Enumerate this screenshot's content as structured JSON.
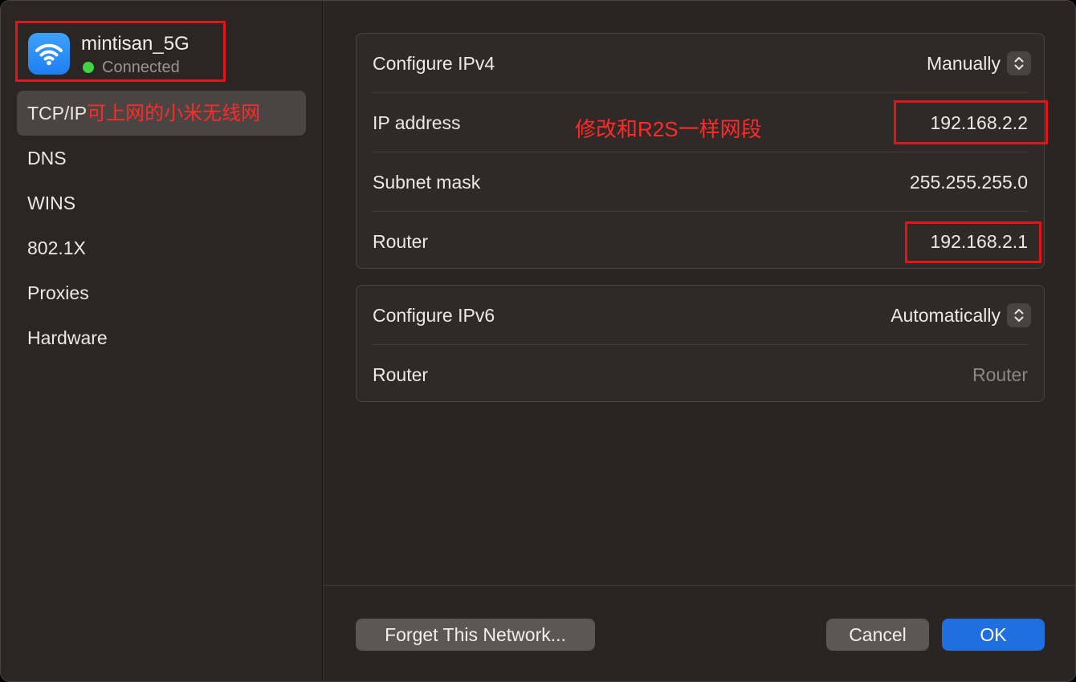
{
  "network": {
    "name": "mintisan_5G",
    "status": "Connected",
    "status_color": "#3fd443",
    "icon": "wifi-icon"
  },
  "sidebar": {
    "items": [
      {
        "label": "TCP/IP",
        "selected": true
      },
      {
        "label": "DNS"
      },
      {
        "label": "WINS"
      },
      {
        "label": "802.1X"
      },
      {
        "label": "Proxies"
      },
      {
        "label": "Hardware"
      }
    ]
  },
  "ipv4": {
    "configure_label": "Configure IPv4",
    "configure_value": "Manually",
    "ip_label": "IP address",
    "ip_value": "192.168.2.2",
    "subnet_label": "Subnet mask",
    "subnet_value": "255.255.255.0",
    "router_label": "Router",
    "router_value": "192.168.2.1"
  },
  "ipv6": {
    "configure_label": "Configure IPv6",
    "configure_value": "Automatically",
    "router_label": "Router",
    "router_placeholder": "Router"
  },
  "annotations": {
    "sidebar_note": "可上网的小米无线网",
    "ip_note": "修改和R2S一样网段",
    "color": "#e0161a"
  },
  "buttons": {
    "forget": "Forget This Network...",
    "cancel": "Cancel",
    "ok": "OK"
  },
  "colors": {
    "accent": "#1f6fe0",
    "background": "#2a2422"
  }
}
